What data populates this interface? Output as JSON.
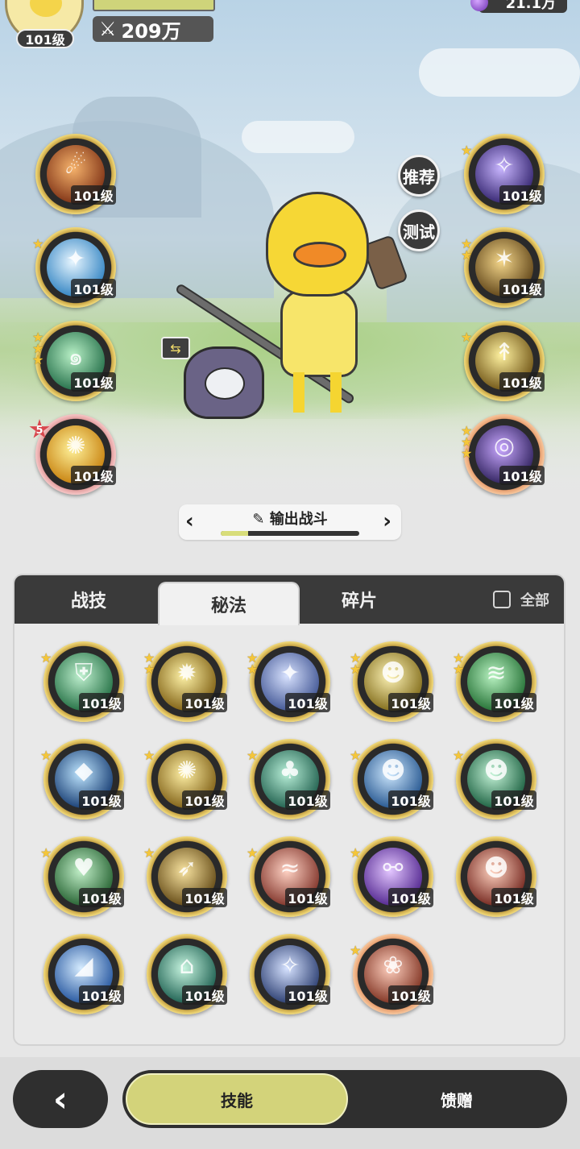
{
  "player": {
    "level": "101级",
    "power": "209万",
    "currency": "21.1万"
  },
  "equipped_left": [
    {
      "level": "101级",
      "stars": 0,
      "glyph": "☄",
      "colors": [
        "#f6b36c",
        "#7a2d12"
      ]
    },
    {
      "level": "101级",
      "stars": 1,
      "glyph": "✦",
      "colors": [
        "#e8f6ff",
        "#2a7fc0"
      ]
    },
    {
      "level": "101级",
      "stars": 3,
      "glyph": "๑",
      "colors": [
        "#b8f0c6",
        "#1f6a45"
      ]
    },
    {
      "level": "101级",
      "badge": "5",
      "glyph": "✺",
      "colors": [
        "#fff29a",
        "#c57c08"
      ],
      "ring": "red"
    }
  ],
  "equipped_right": [
    {
      "level": "101级",
      "stars": 1,
      "glyph": "✧",
      "colors": [
        "#c9b6ff",
        "#2e1f6a"
      ]
    },
    {
      "level": "101级",
      "stars": 2,
      "glyph": "✶",
      "colors": [
        "#f4d68a",
        "#5a3f14"
      ]
    },
    {
      "level": "101级",
      "stars": 1,
      "glyph": "↟",
      "colors": [
        "#fff2a0",
        "#6a4e10"
      ]
    },
    {
      "level": "101级",
      "stars": 3,
      "glyph": "◎",
      "colors": [
        "#c9a8ff",
        "#2a1d58"
      ],
      "ring": "copper"
    }
  ],
  "side_buttons": {
    "recommend": "推荐",
    "test": "测试"
  },
  "swap_icon": "⇆",
  "preset": {
    "label": "输出战斗",
    "progress": 0.2
  },
  "tabs": [
    {
      "label": "战技",
      "active": false
    },
    {
      "label": "秘法",
      "active": true
    },
    {
      "label": "碎片",
      "active": false
    }
  ],
  "select_all_label": "全部",
  "skills": [
    {
      "level": "101级",
      "stars": 1,
      "glyph": "⛨",
      "colors": [
        "#bff0cf",
        "#1e6b3f"
      ]
    },
    {
      "level": "101级",
      "stars": 2,
      "glyph": "✹",
      "colors": [
        "#fff3a8",
        "#7a5a0d"
      ]
    },
    {
      "level": "101级",
      "stars": 2,
      "glyph": "✦",
      "colors": [
        "#d9e3ff",
        "#3a4f8f"
      ]
    },
    {
      "level": "101级",
      "stars": 2,
      "glyph": "☻",
      "colors": [
        "#fff5b8",
        "#7c6613"
      ]
    },
    {
      "level": "101级",
      "stars": 2,
      "glyph": "≋",
      "colors": [
        "#b9f3c2",
        "#1d6a2e"
      ]
    },
    {
      "level": "101级",
      "stars": 1,
      "glyph": "◆",
      "colors": [
        "#bfe6ff",
        "#10366d"
      ]
    },
    {
      "level": "101级",
      "stars": 1,
      "glyph": "✺",
      "colors": [
        "#fff0a5",
        "#7a5a10"
      ]
    },
    {
      "level": "101级",
      "stars": 1,
      "glyph": "♣",
      "colors": [
        "#b9f0d9",
        "#1a5a48"
      ]
    },
    {
      "level": "101级",
      "stars": 1,
      "glyph": "☻",
      "colors": [
        "#cfe9ff",
        "#1d4f8a"
      ]
    },
    {
      "level": "101级",
      "stars": 1,
      "glyph": "☻",
      "colors": [
        "#c6f5d9",
        "#145a3a"
      ]
    },
    {
      "level": "101级",
      "stars": 1,
      "glyph": "♥",
      "colors": [
        "#c2f0c9",
        "#1f5c2b"
      ]
    },
    {
      "level": "101级",
      "stars": 1,
      "glyph": "➶",
      "colors": [
        "#f8e3a0",
        "#5e4410"
      ]
    },
    {
      "level": "101级",
      "stars": 1,
      "glyph": "≈",
      "colors": [
        "#ffd2c4",
        "#7a2c22"
      ]
    },
    {
      "level": "101级",
      "stars": 1,
      "glyph": "⚯",
      "colors": [
        "#e3c6ff",
        "#4b1f8a"
      ]
    },
    {
      "level": "101级",
      "stars": 0,
      "glyph": "☻",
      "colors": [
        "#ffd2c0",
        "#6e2018"
      ]
    },
    {
      "level": "101级",
      "stars": 0,
      "glyph": "◢",
      "colors": [
        "#d6ecff",
        "#1d4f9a"
      ]
    },
    {
      "level": "101级",
      "stars": 0,
      "glyph": "⌂",
      "colors": [
        "#c7f5e0",
        "#15594a"
      ]
    },
    {
      "level": "101级",
      "stars": 0,
      "glyph": "✧",
      "colors": [
        "#d6e2ff",
        "#23366a"
      ]
    },
    {
      "level": "101级",
      "stars": 1,
      "glyph": "❀",
      "colors": [
        "#ffd0bf",
        "#7a2c1b"
      ],
      "ring": "copper"
    }
  ],
  "bottom": {
    "back_icon": "chevron-left-icon",
    "skills_label": "技能",
    "gift_label": "馈赠"
  }
}
